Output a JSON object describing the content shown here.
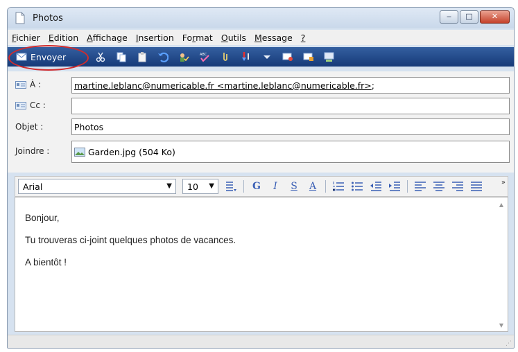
{
  "window": {
    "title": "Photos",
    "controls": {
      "minimize": "‒",
      "maximize": "□",
      "close": "✕"
    }
  },
  "menu": [
    {
      "u": "F",
      "rest": "ichier"
    },
    {
      "u": "E",
      "rest": "dition"
    },
    {
      "u": "A",
      "rest": "ffichage"
    },
    {
      "u": "I",
      "rest": "nsertion"
    },
    {
      "pre": "Fo",
      "u": "r",
      "rest": "mat"
    },
    {
      "u": "O",
      "rest": "utils"
    },
    {
      "u": "M",
      "rest": "essage"
    },
    {
      "u": "?",
      "rest": ""
    }
  ],
  "toolbar": {
    "send_label": "Envoyer",
    "icons": [
      "cut-icon",
      "copy-icon",
      "paste-icon",
      "undo-icon",
      "check-names-icon",
      "spell-check-icon",
      "attach-icon",
      "priority-icon",
      "priority-dropdown-icon",
      "sign-icon",
      "encrypt-icon",
      "offline-icon"
    ],
    "colors": {
      "bar": "#1f4685",
      "highlight": "#d42b2b"
    }
  },
  "headers": {
    "to_label": "À :",
    "to_value": "martine.leblanc@numericable.fr <martine.leblanc@numericable.fr>",
    "to_suffix": ";",
    "cc_label": "Cc :",
    "cc_value": "",
    "subject_label": "Objet :",
    "subject_value": "Photos",
    "attach_label": "Joindre :",
    "attach_value": "Garden.jpg (504 Ko)"
  },
  "format": {
    "font": "Arial",
    "size": "10",
    "bold": "G",
    "italic": "I",
    "underline": "S",
    "color": "A"
  },
  "body": {
    "lines": [
      "Bonjour,",
      "Tu trouveras ci-joint quelques photos de vacances.",
      "A bientôt !"
    ]
  }
}
